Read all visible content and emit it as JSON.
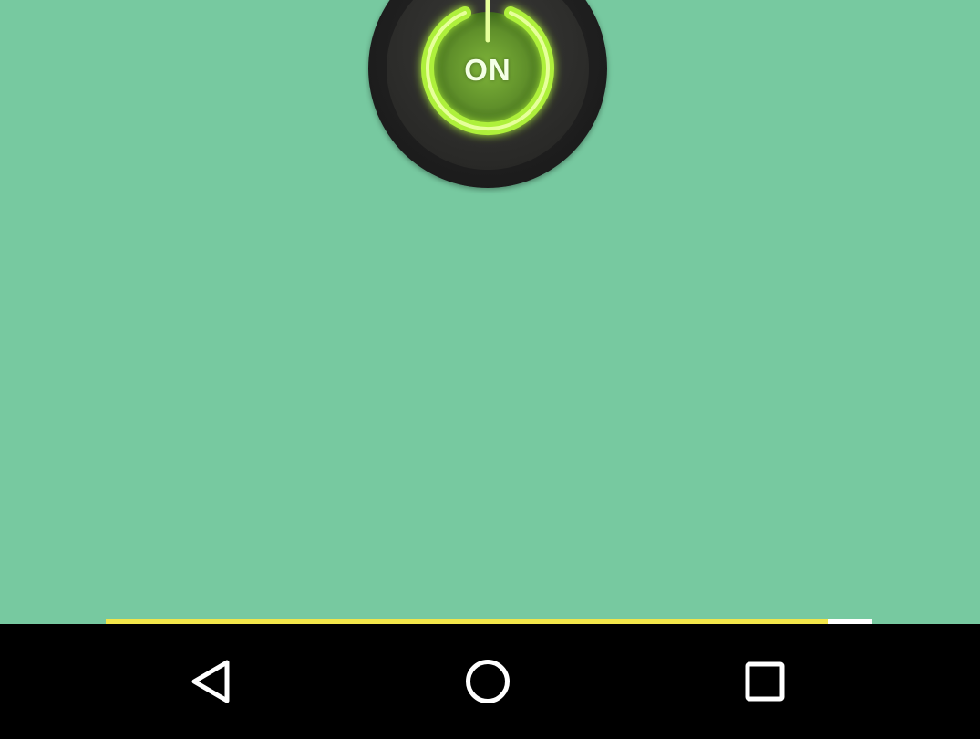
{
  "power": {
    "label": "ON",
    "state": "on",
    "icon": "power-icon",
    "glow_color": "#b6f23a"
  },
  "ad_banner": {
    "color": "#f2e64a"
  },
  "navigation": {
    "back": "back-icon",
    "home": "home-icon",
    "recents": "recents-icon"
  },
  "colors": {
    "background": "#77c9a0",
    "nav_bar": "#000000"
  }
}
